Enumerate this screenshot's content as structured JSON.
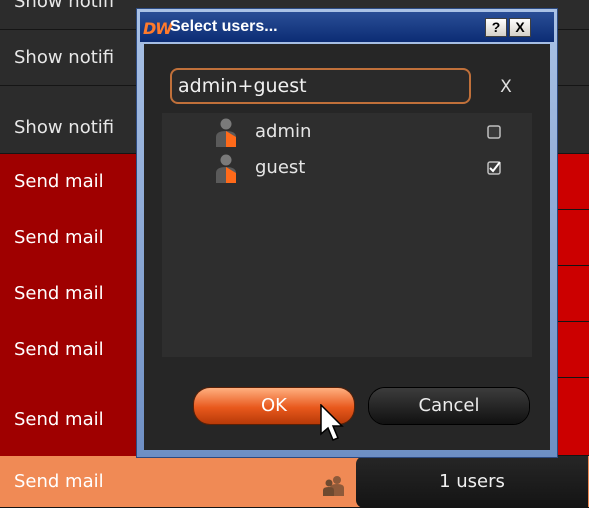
{
  "background_rows": [
    {
      "label": "Show notifi",
      "style": "dark"
    },
    {
      "label": "Show notifi",
      "style": "dark"
    },
    {
      "label": "Show notifi",
      "style": "dark"
    },
    {
      "label": "Send mail",
      "style": "red"
    },
    {
      "label": "Send mail",
      "style": "red"
    },
    {
      "label": "Send mail",
      "style": "red"
    },
    {
      "label": "Send mail",
      "style": "red"
    },
    {
      "label": "Send mail",
      "style": "red"
    },
    {
      "label": "Send mail",
      "style": "selected",
      "users": "1 users"
    }
  ],
  "dialog": {
    "app_logo": "DW",
    "title": "Select users...",
    "help_label": "?",
    "close_label": "X",
    "search_value": "admin+guest",
    "clear_label": "X",
    "users": [
      {
        "name": "admin",
        "checked": false
      },
      {
        "name": "guest",
        "checked": true
      }
    ],
    "ok_label": "OK",
    "cancel_label": "Cancel"
  },
  "colors": {
    "accent_orange": "#e8581c",
    "alarm_red": "#cc0000",
    "title_blue": "#0c2c74"
  }
}
